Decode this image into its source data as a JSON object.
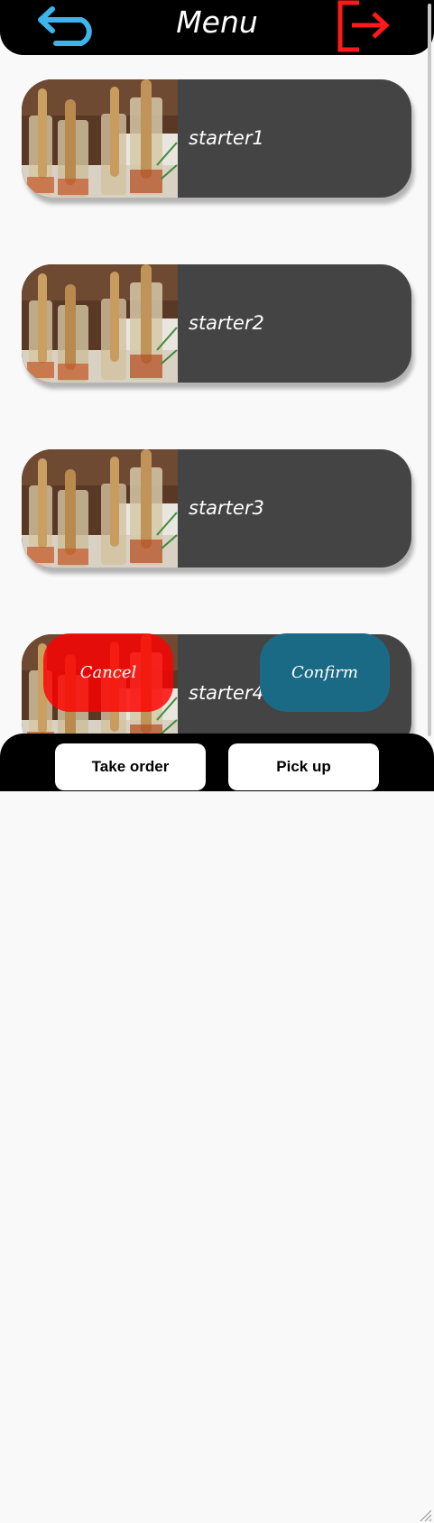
{
  "header": {
    "title": "Menu",
    "back_icon": "back-arrow-icon",
    "logout_icon": "logout-icon",
    "back_color": "#3bb5ea",
    "logout_color": "#ff1a1a"
  },
  "menu_items": [
    {
      "name": "starter1",
      "image": "starter-dish-image"
    },
    {
      "name": "starter2",
      "image": "starter-dish-image"
    },
    {
      "name": "starter3",
      "image": "starter-dish-image"
    },
    {
      "name": "starter4",
      "image": "starter-dish-image"
    }
  ],
  "dialog": {
    "cancel_label": "Cancel",
    "confirm_label": "Confirm",
    "cancel_color": "#ff0000",
    "confirm_color": "#1a6a86"
  },
  "footer": {
    "take_order_label": "Take order",
    "pick_up_label": "Pick up"
  }
}
